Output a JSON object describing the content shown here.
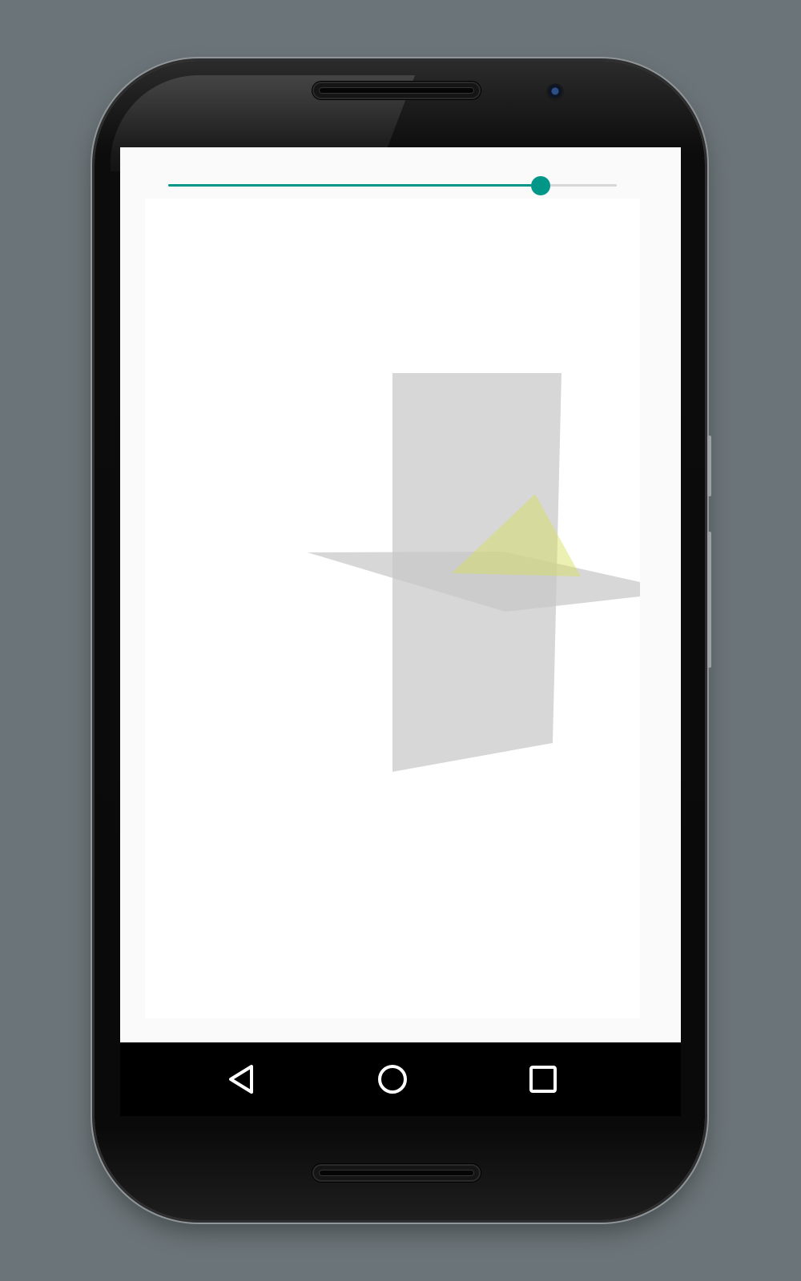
{
  "slider": {
    "value": 0.83,
    "active_color": "#009688",
    "inactive_color": "#d6d6d6"
  },
  "scene": {
    "description_shapes": [
      "vertical-plane",
      "horizontal-plane",
      "triangle"
    ],
    "plane_color": "#c8c8c8",
    "triangle_color": "#d4e157"
  },
  "navigation_bar": {
    "back_icon": "back-triangle-icon",
    "home_icon": "home-circle-icon",
    "recents_icon": "recents-square-icon"
  },
  "colors": {
    "background": "#6b7478",
    "app_background": "#fafafa",
    "canvas_background": "#ffffff"
  }
}
